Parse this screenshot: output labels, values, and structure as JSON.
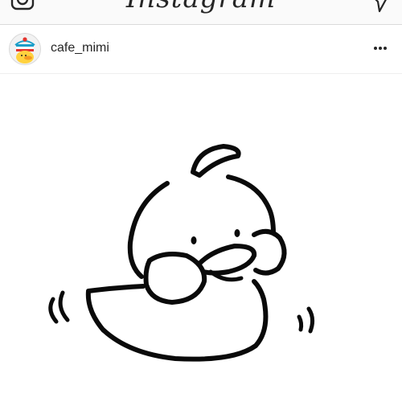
{
  "top_bar": {
    "app_name": "Instagram",
    "icons": {
      "left": "camera-icon",
      "right": "direct-message-icon"
    }
  },
  "post": {
    "username": "cafe_mimi",
    "avatar_icon": "duck-avatar",
    "menu_icon": "more-options-icon",
    "image_subject": "duck-illustration"
  },
  "colors": {
    "bar_background": "#fafafa",
    "divider": "#dbdbdb",
    "text": "#262626",
    "avatar_ring": "#1a9ec9"
  }
}
